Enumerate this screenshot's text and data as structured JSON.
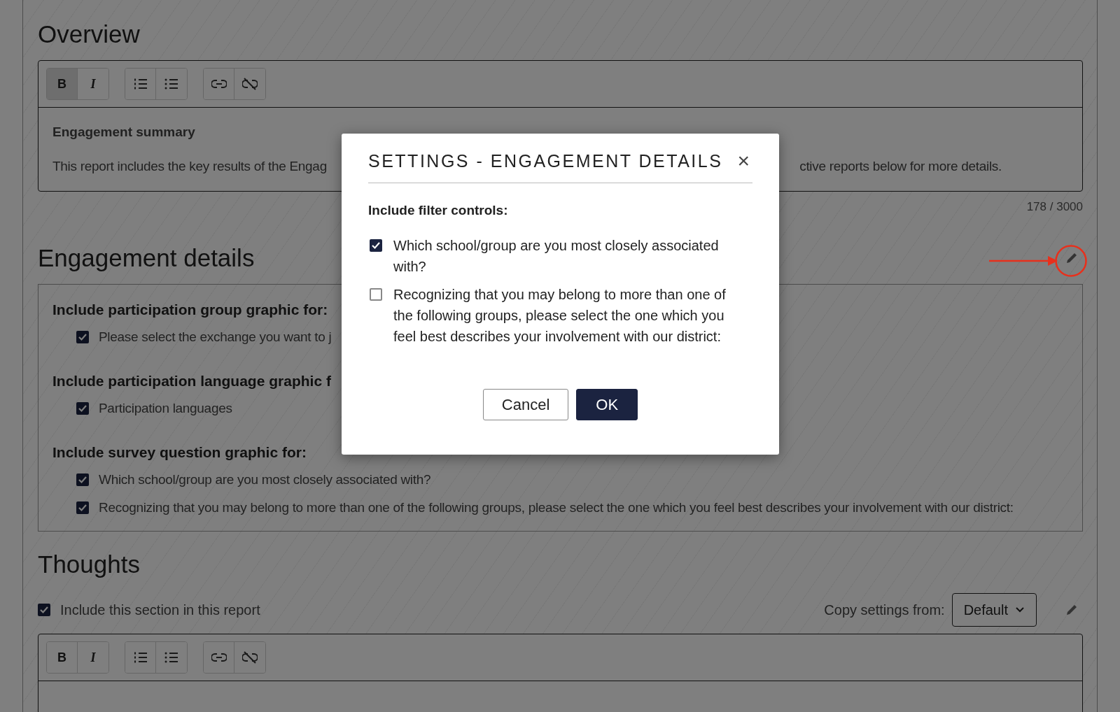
{
  "overview": {
    "title": "Overview",
    "toolbar": [
      [
        {
          "kind": "bold",
          "label": "B",
          "selected": true
        },
        {
          "kind": "italic",
          "label": "I",
          "selected": false
        }
      ],
      [
        {
          "kind": "ordered-list",
          "selected": false
        },
        {
          "kind": "bullet-list",
          "selected": false
        }
      ],
      [
        {
          "kind": "link",
          "selected": false
        },
        {
          "kind": "unlink",
          "selected": false
        }
      ]
    ],
    "heading": "Engagement summary",
    "text_start": "This report includes the key results of the Engag",
    "text_end": "ctive reports below for more details.",
    "counter": "178 / 3000"
  },
  "engagement_details": {
    "title": "Engagement details",
    "groups": [
      {
        "heading": "Include participation group graphic for:",
        "items": [
          {
            "label": "Please select the exchange you want to j",
            "checked": true
          }
        ]
      },
      {
        "heading": "Include participation language graphic f",
        "items": [
          {
            "label": "Participation languages",
            "checked": true
          }
        ]
      },
      {
        "heading": "Include survey question graphic for:",
        "items": [
          {
            "label": "Which school/group are you most closely associated with?",
            "checked": true
          },
          {
            "label": "Recognizing that you may belong to more than one of the following groups, please select the one which you feel best describes your involvement with our district:",
            "checked": true
          }
        ]
      }
    ]
  },
  "thoughts": {
    "title": "Thoughts",
    "include": {
      "label": "Include this section in this report",
      "checked": true
    },
    "copy_label": "Copy settings from:",
    "copy_value": "Default",
    "toolbar": [
      [
        {
          "kind": "bold",
          "label": "B",
          "selected": false
        },
        {
          "kind": "italic",
          "label": "I",
          "selected": false
        }
      ],
      [
        {
          "kind": "ordered-list",
          "selected": false
        },
        {
          "kind": "bullet-list",
          "selected": false
        }
      ],
      [
        {
          "kind": "link",
          "selected": false
        },
        {
          "kind": "unlink",
          "selected": false
        }
      ]
    ]
  },
  "dialog": {
    "title": "SETTINGS - ENGAGEMENT DETAILS",
    "close": "×",
    "label": "Include filter controls:",
    "options": [
      {
        "label": "Which school/group are you most closely associated with?",
        "checked": true
      },
      {
        "label": "Recognizing that you may belong to more than one of the following groups, please select the one which you feel best describes your involvement with our district:",
        "checked": false
      }
    ],
    "buttons": [
      {
        "label": "Cancel",
        "kind": "secondary"
      },
      {
        "label": "OK",
        "kind": "primary"
      }
    ]
  }
}
